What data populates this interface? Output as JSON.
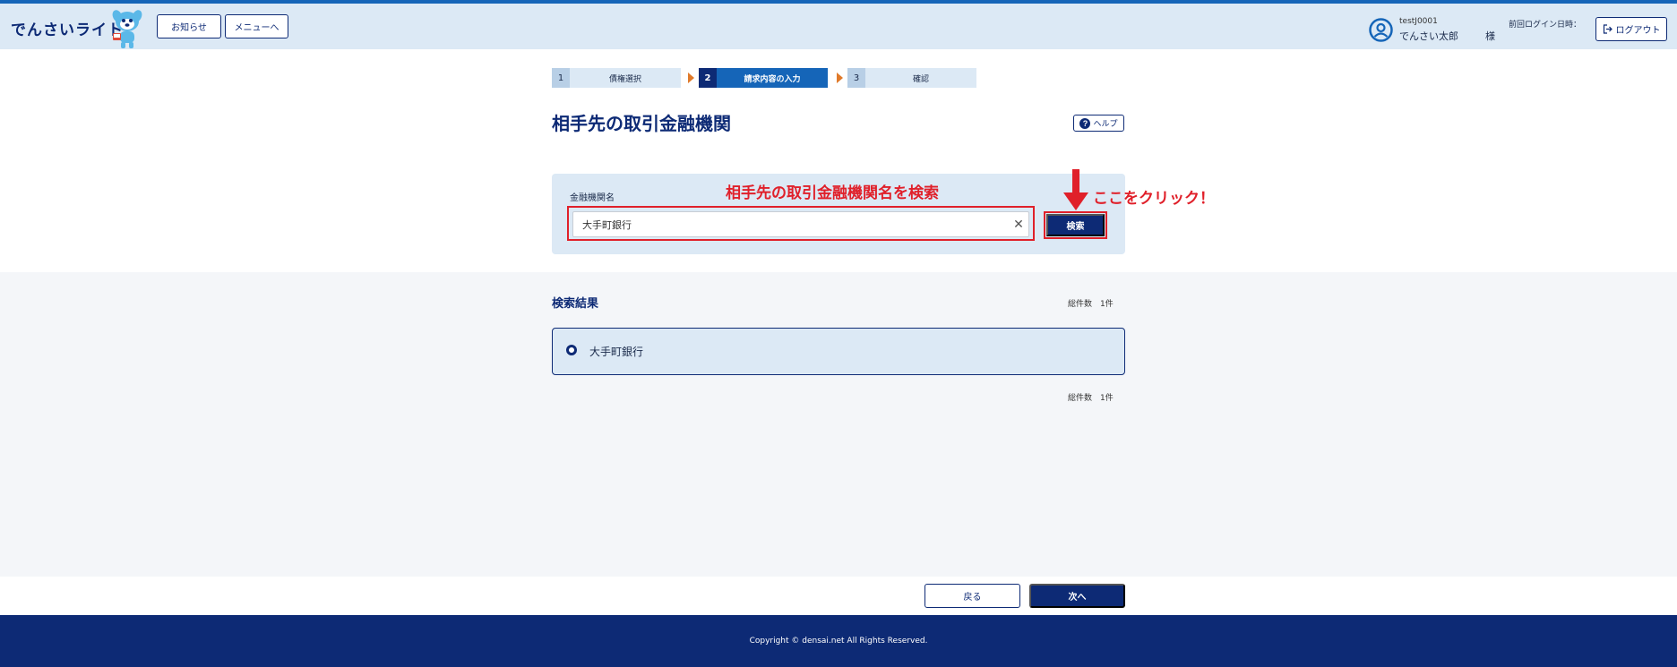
{
  "header": {
    "logo_text": "でんさいライト",
    "notice_button": "お知らせ",
    "menu_button": "メニューへ",
    "user_id": "testJ0001",
    "user_name": "でんさい太郎",
    "user_honorific": "様",
    "last_login_label": "前回ログイン日時：",
    "logout_button": "ログアウト"
  },
  "steps": [
    {
      "num": "1",
      "label": "債権選択",
      "state": "inactive"
    },
    {
      "num": "2",
      "label": "請求内容の入力",
      "state": "active"
    },
    {
      "num": "3",
      "label": "確認",
      "state": "inactive"
    }
  ],
  "page": {
    "title": "相手先の取引金融機関",
    "help_button": "ヘルプ"
  },
  "search": {
    "field_label": "金融機関名",
    "input_value": "大手町銀行",
    "search_button": "検索"
  },
  "annotations": {
    "search_hint": "相手先の取引金融機関名を検索",
    "click_hint": "ここをクリック！"
  },
  "results": {
    "title": "検索結果",
    "count_top": "総件数　1件",
    "count_bottom": "総件数　1件",
    "items": [
      {
        "label": "大手町銀行"
      }
    ]
  },
  "actions": {
    "back_button": "戻る",
    "next_button": "次へ"
  },
  "footer": {
    "copyright": "Copyright © densai.net All Rights Reserved."
  },
  "colors": {
    "navy": "#0d2a75",
    "blue": "#1565b8",
    "light_blue": "#dce9f5",
    "annotation_red": "#e0202a",
    "step_arrow": "#e07a2a"
  }
}
